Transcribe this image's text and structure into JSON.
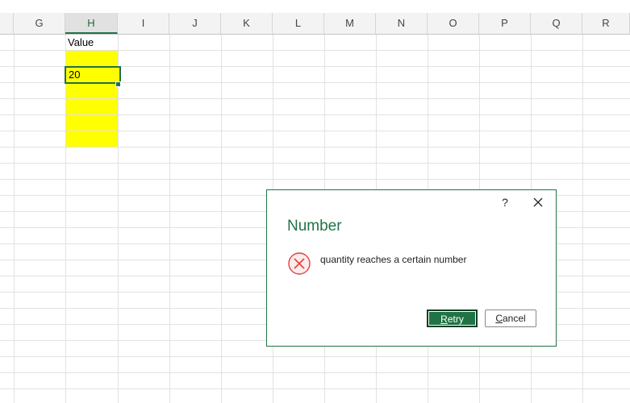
{
  "columns": [
    "G",
    "H",
    "I",
    "J",
    "K",
    "L",
    "M",
    "N",
    "O",
    "P",
    "Q",
    "R"
  ],
  "active_column": "H",
  "cells": {
    "h1": "Value",
    "h3": "20"
  },
  "colors": {
    "excel_green": "#217346",
    "highlight_yellow": "#ffff00",
    "error_red": "#e04040"
  },
  "dialog": {
    "help_label": "?",
    "close_icon": "close-icon",
    "title": "Number",
    "icon": "error-circle-x-icon",
    "message": "quantity reaches a certain number",
    "retry_label_mnemonic": "R",
    "retry_label_rest": "etry",
    "cancel_label_mnemonic": "C",
    "cancel_label_rest": "ancel"
  }
}
